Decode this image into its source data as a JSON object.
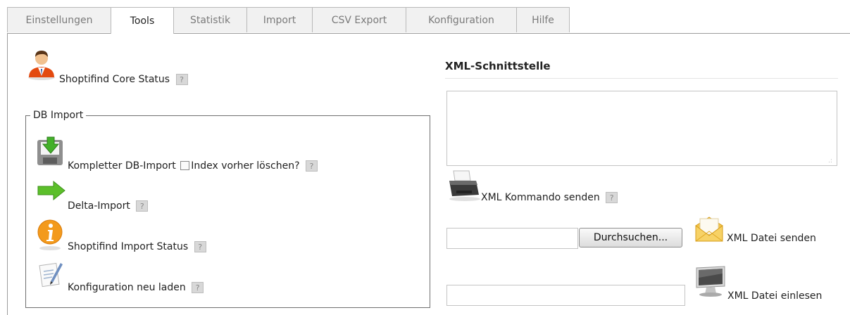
{
  "tabs": [
    "Einstellungen",
    "Tools",
    "Statistik",
    "Import",
    "CSV Export",
    "Konfiguration",
    "Hilfe"
  ],
  "help_glyph": "?",
  "core_status": {
    "label": "Shoptifind Core Status",
    "icon": "user-icon"
  },
  "db_import": {
    "legend": "DB Import",
    "full_import": {
      "label": "Kompletter DB-Import",
      "checkbox_label": "Index vorher löschen?",
      "icon": "database-download-icon"
    },
    "delta_import": {
      "label": "Delta-Import",
      "icon": "green-arrow-icon"
    },
    "import_status": {
      "label": "Shoptifind Import Status",
      "icon": "info-icon"
    },
    "reload_config": {
      "label": "Konfiguration neu laden",
      "icon": "document-edit-icon"
    }
  },
  "xml": {
    "heading": "XML-Schnittstelle",
    "textarea_value": "",
    "send_command": {
      "label": "XML Kommando senden",
      "icon": "printer-icon"
    },
    "browse_button": "Durchsuchen...",
    "send_file": {
      "label": "XML Datei senden",
      "icon": "envelope-icon"
    },
    "read_file": {
      "label": "XML Datei einlesen",
      "icon": "monitor-icon"
    }
  }
}
